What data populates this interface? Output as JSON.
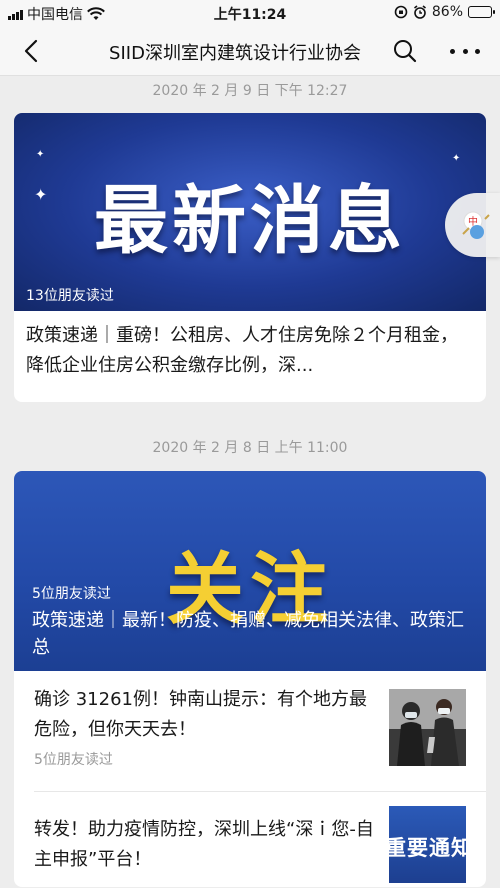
{
  "status_bar": {
    "carrier": "中国电信",
    "time": "上午11:24",
    "battery_percent": "86%",
    "battery_level": 0.86
  },
  "nav": {
    "title": "SIID深圳室内建筑设计行业协会"
  },
  "messages": [
    {
      "timestamp": "2020 年 2 月 9 日 下午 12:27",
      "banner_title": "最新消息",
      "readers": "13位朋友读过",
      "headline": "政策速递｜重磅！公租房、人才住房免除２个月租金，降低企业住房公积金缴存比例，深..."
    },
    {
      "timestamp": "2020 年 2 月 8 日 上午 11:00",
      "banner_title": "关注",
      "readers": "5位朋友读过",
      "headline": "政策速递｜最新！防疫、捐赠、减免相关法律、政策汇总",
      "items": [
        {
          "title": "确诊 31261例！钟南山提示：有个地方最危险，但你天天去！",
          "readers": "5位朋友读过"
        },
        {
          "title": "转发！助力疫情防控，深圳上线“深ｉ您-自主申报”平台！",
          "thumb_text": "重要通知"
        }
      ]
    }
  ],
  "colors": {
    "banner_blue": "#1f3a94",
    "title_yellow": "#f5cf33",
    "background": "#ededed"
  }
}
